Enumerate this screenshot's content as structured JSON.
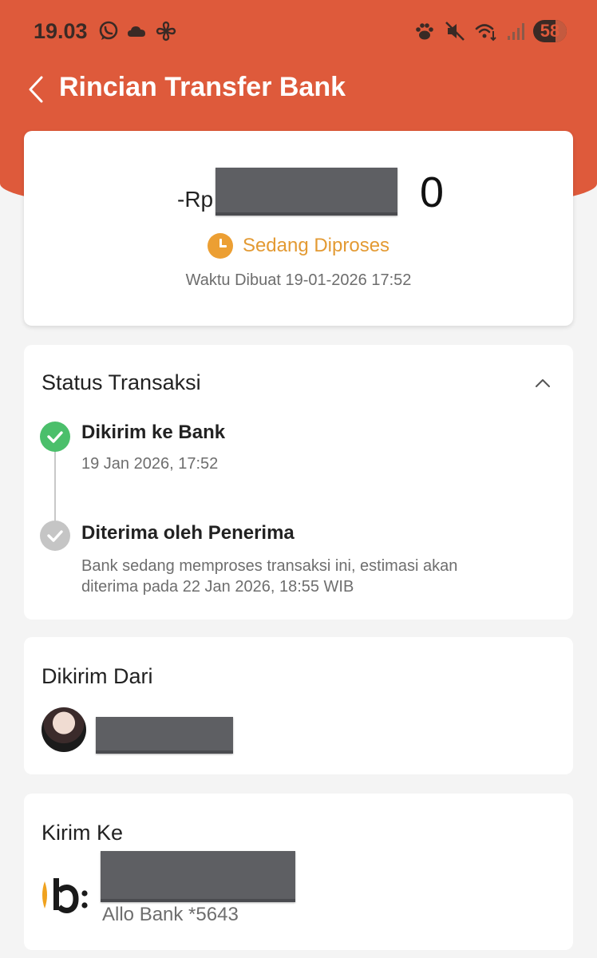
{
  "status_bar": {
    "time": "19.03",
    "battery": "58",
    "left_icons": [
      "whatsapp-icon",
      "cloud-icon",
      "pinwheel-icon"
    ],
    "right_icons": [
      "paw-icon",
      "mute-icon",
      "wifi-icon",
      "signal-icon",
      "battery-icon"
    ]
  },
  "header": {
    "title": "Rincian Transfer Bank"
  },
  "summary": {
    "amount_prefix": "-Rp",
    "amount_suffix": "0",
    "status": "Sedang Diproses",
    "created_time": "Waktu Dibuat 19-01-2026 17:52"
  },
  "transaction_status": {
    "title": "Status Transaksi",
    "steps": [
      {
        "title": "Dikirim ke Bank",
        "subtitle": "19 Jan 2026, 17:52"
      },
      {
        "title": "Diterima oleh Penerima",
        "subtitle_line1": "Bank sedang memproses transaksi ini, estimasi akan",
        "subtitle_line2": "diterima pada 22 Jan 2026, 18:55 WIB"
      }
    ]
  },
  "sender": {
    "title": "Dikirim Dari"
  },
  "recipient": {
    "title": "Kirim Ke",
    "bank_account": "Allo Bank *5643"
  },
  "colors": {
    "header": "#de5a3b",
    "status_processing": "#e39a33",
    "step_done": "#4bbf6b",
    "step_pending": "#c5c5c5"
  }
}
